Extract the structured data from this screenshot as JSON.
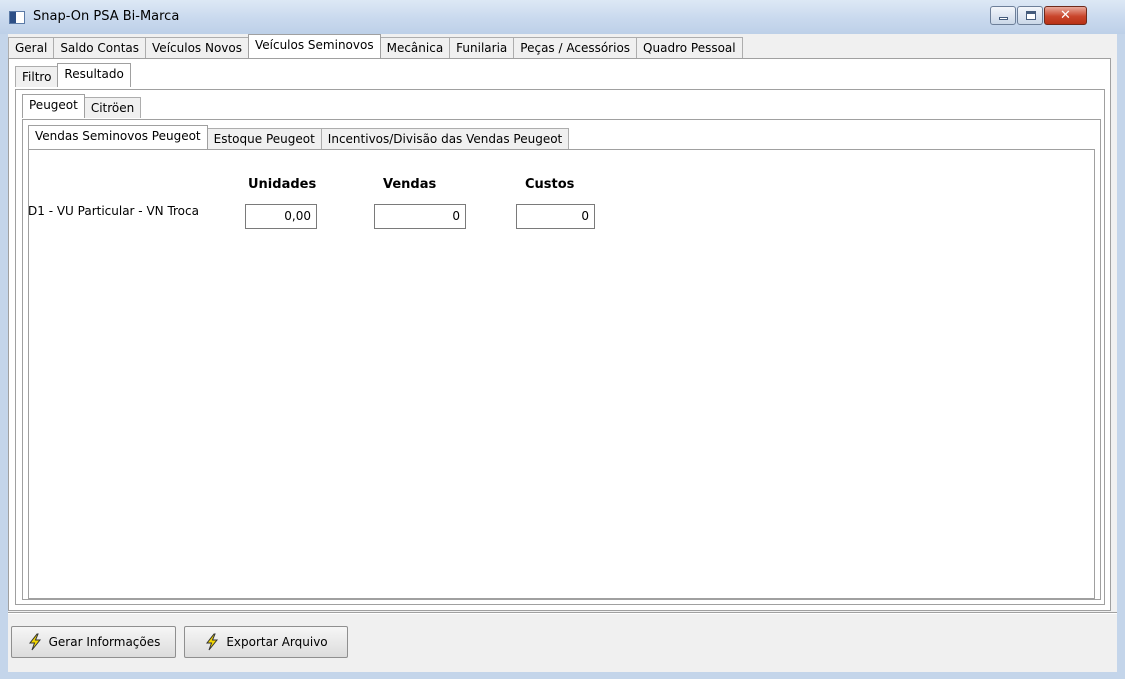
{
  "window": {
    "title": "Snap-On PSA Bi-Marca",
    "close_glyph": "✕"
  },
  "main_tabs": [
    "Geral",
    "Saldo Contas",
    "Veículos Novos",
    "Veículos Seminovos",
    "Mecânica",
    "Funilaria",
    "Peças / Acessórios",
    "Quadro Pessoal"
  ],
  "main_tab_active": "Veículos Seminovos",
  "sub_tabs": [
    "Filtro",
    "Resultado"
  ],
  "sub_tab_active": "Resultado",
  "brand_tabs": [
    "Peugeot",
    "Citröen"
  ],
  "brand_tab_active": "Peugeot",
  "report_tabs": [
    "Vendas Seminovos Peugeot",
    "Estoque Peugeot",
    "Incentivos/Divisão das Vendas Peugeot"
  ],
  "report_tab_active": "Vendas Seminovos Peugeot",
  "columns": {
    "unidades": "Unidades",
    "vendas": "Vendas",
    "custos": "Custos"
  },
  "rows": [
    {
      "label": "D1 - VU Particular - VN Troca",
      "unidades": "0,00",
      "vendas": "0",
      "custos": "0"
    }
  ],
  "buttons": {
    "gerar": "Gerar Informações",
    "exportar": "Exportar Arquivo"
  },
  "icons": {
    "app": "app-window-icon",
    "action": "lightning-bolt-icon"
  },
  "colors": {
    "title_bar": "#c9d9ee",
    "close_button": "#c9452c",
    "bolt": "#f5d800"
  }
}
